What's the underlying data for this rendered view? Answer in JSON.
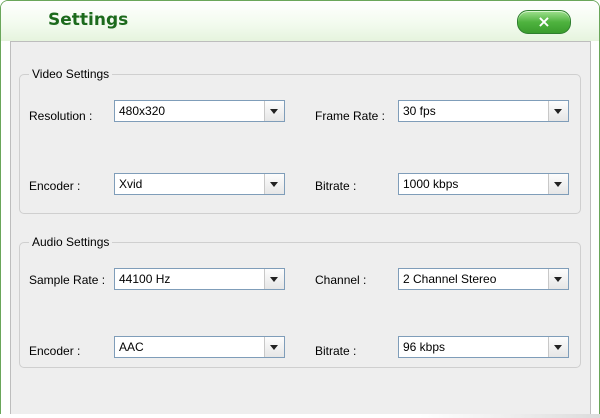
{
  "window": {
    "title": "Settings",
    "close_label": "×",
    "accent_color": "#3a9c2d"
  },
  "video": {
    "section_title": "Video Settings",
    "resolution": {
      "label": "Resolution :",
      "value": "480x320"
    },
    "frame_rate": {
      "label": "Frame Rate :",
      "value": "30 fps"
    },
    "encoder": {
      "label": "Encoder :",
      "value": "Xvid"
    },
    "bitrate": {
      "label": "Bitrate :",
      "value": "1000 kbps"
    }
  },
  "audio": {
    "section_title": "Audio Settings",
    "sample_rate": {
      "label": "Sample Rate :",
      "value": "44100 Hz"
    },
    "channel": {
      "label": "Channel :",
      "value": "2 Channel Stereo"
    },
    "encoder": {
      "label": "Encoder :",
      "value": "AAC"
    },
    "bitrate": {
      "label": "Bitrate :",
      "value": "96 kbps"
    }
  }
}
